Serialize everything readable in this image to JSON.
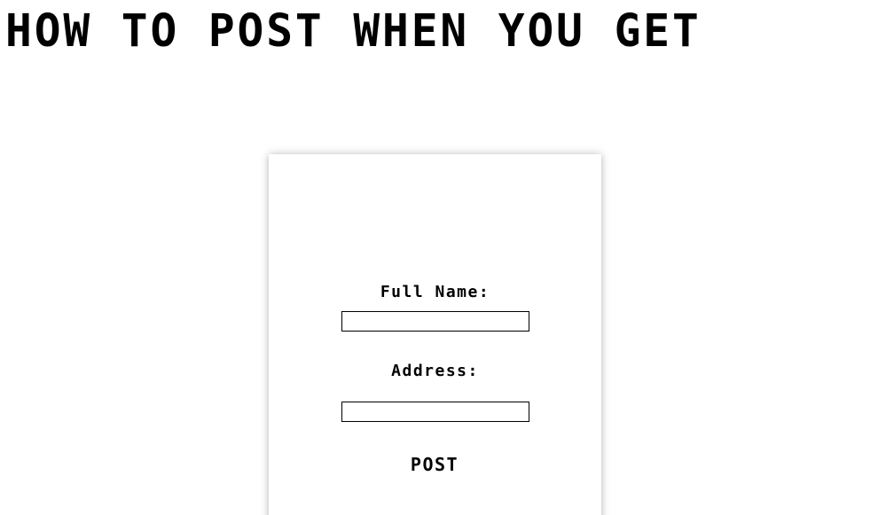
{
  "header": {
    "title": "HOW TO POST WHEN YOU GET"
  },
  "form": {
    "full_name_label": "Full Name:",
    "full_name_value": "",
    "address_label": "Address:",
    "address_value": "",
    "submit_label": "POST"
  }
}
